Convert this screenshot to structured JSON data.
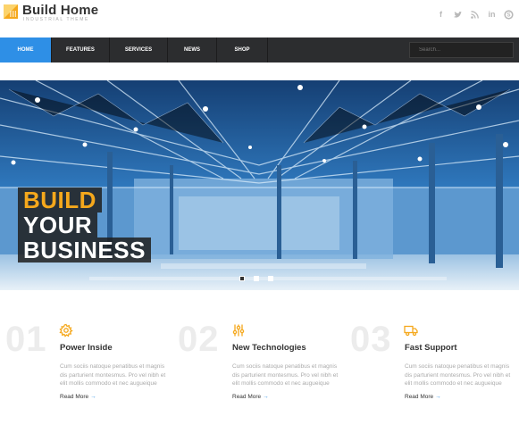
{
  "brand": {
    "title": "Build Home",
    "subtitle": "Industrial Theme",
    "accent": "#f5a81c"
  },
  "social": [
    {
      "icon": "facebook-icon",
      "glyph": "f"
    },
    {
      "icon": "twitter-icon",
      "glyph": "t"
    },
    {
      "icon": "rss-icon",
      "glyph": ")"
    },
    {
      "icon": "linkedin-icon",
      "glyph": "in"
    },
    {
      "icon": "skype-icon",
      "glyph": "s"
    }
  ],
  "nav": {
    "items": [
      {
        "label": "Home",
        "active": true
      },
      {
        "label": "Features",
        "active": false
      },
      {
        "label": "Services",
        "active": false
      },
      {
        "label": "News",
        "active": false
      },
      {
        "label": "Shop",
        "active": false
      }
    ],
    "search_placeholder": "Search..."
  },
  "hero": {
    "line1": "BUILD",
    "line2": "YOUR",
    "line3": "BUSINESS",
    "slide_count": 3,
    "active_slide": 1,
    "highlight_color": "#f5a81c"
  },
  "features": [
    {
      "number": "01",
      "icon": "gear-icon",
      "title": "Power Inside",
      "text": "Cum sociis natoque penatibus et magnis dis parturient montesmus. Pro vel nibh et elit mollis commodo et nec augueique",
      "link": "Read More"
    },
    {
      "number": "02",
      "icon": "sliders-icon",
      "title": "New Technologies",
      "text": "Cum sociis natoque penatibus et magnis dis parturient montesmus. Pro vel nibh et elit mollis commodo et nec augueique",
      "link": "Read More"
    },
    {
      "number": "03",
      "icon": "truck-icon",
      "title": "Fast Support",
      "text": "Cum sociis natoque penatibus et magnis dis parturient montesmus. Pro vel nibh et elit mollis commodo et nec augueique",
      "link": "Read More"
    }
  ],
  "colors": {
    "nav_bg": "#2c2d2f",
    "nav_active": "#2e8fe6",
    "link_arrow": "#2e8fe6",
    "icon_orange": "#f5a81c"
  }
}
